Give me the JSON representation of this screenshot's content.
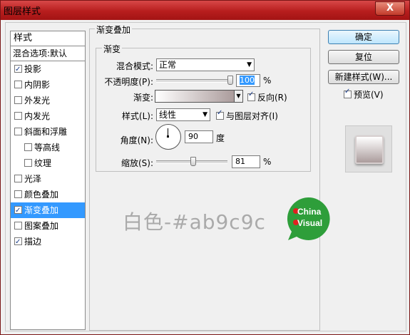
{
  "window": {
    "title": "图层样式",
    "close_label": "X"
  },
  "styles_list": {
    "header": "样式",
    "blend_options": "混合选项:默认",
    "items": [
      {
        "label": "投影",
        "checked": true
      },
      {
        "label": "内阴影",
        "checked": false
      },
      {
        "label": "外发光",
        "checked": false
      },
      {
        "label": "内发光",
        "checked": false
      },
      {
        "label": "斜面和浮雕",
        "checked": false
      },
      {
        "label": "等高线",
        "checked": false
      },
      {
        "label": "纹理",
        "checked": false
      },
      {
        "label": "光泽",
        "checked": false
      },
      {
        "label": "颜色叠加",
        "checked": false
      },
      {
        "label": "渐变叠加",
        "checked": true
      },
      {
        "label": "图案叠加",
        "checked": false
      },
      {
        "label": "描边",
        "checked": true
      }
    ]
  },
  "gradient_overlay": {
    "group_title": "渐变叠加",
    "inner_title": "渐变",
    "blend_mode_label": "混合模式:",
    "blend_mode_value": "正常",
    "opacity_label": "不透明度(P):",
    "opacity_value": "100",
    "opacity_unit": "%",
    "gradient_label": "渐变:",
    "reverse_label": "反向(R)",
    "reverse_checked": true,
    "style_label": "样式(L):",
    "style_value": "线性",
    "align_label": "与图层对齐(I)",
    "align_checked": true,
    "angle_label": "角度(N):",
    "angle_value": "90",
    "angle_unit": "度",
    "scale_label": "缩放(S):",
    "scale_value": "81",
    "scale_unit": "%",
    "gradient_start_color": "#ffffff",
    "gradient_end_color": "#ab9c9c"
  },
  "annotation": {
    "text": "白色-#ab9c9c"
  },
  "logo": {
    "line1": "China",
    "line2": "Visual",
    "color": "#2e9e3a"
  },
  "right_panel": {
    "ok_label": "确定",
    "reset_label": "复位",
    "new_style_label": "新建样式(W)...",
    "preview_label": "预览(V)",
    "preview_checked": true
  },
  "colors": {
    "titlebar": "#b71d1d",
    "selection": "#3399ff"
  }
}
